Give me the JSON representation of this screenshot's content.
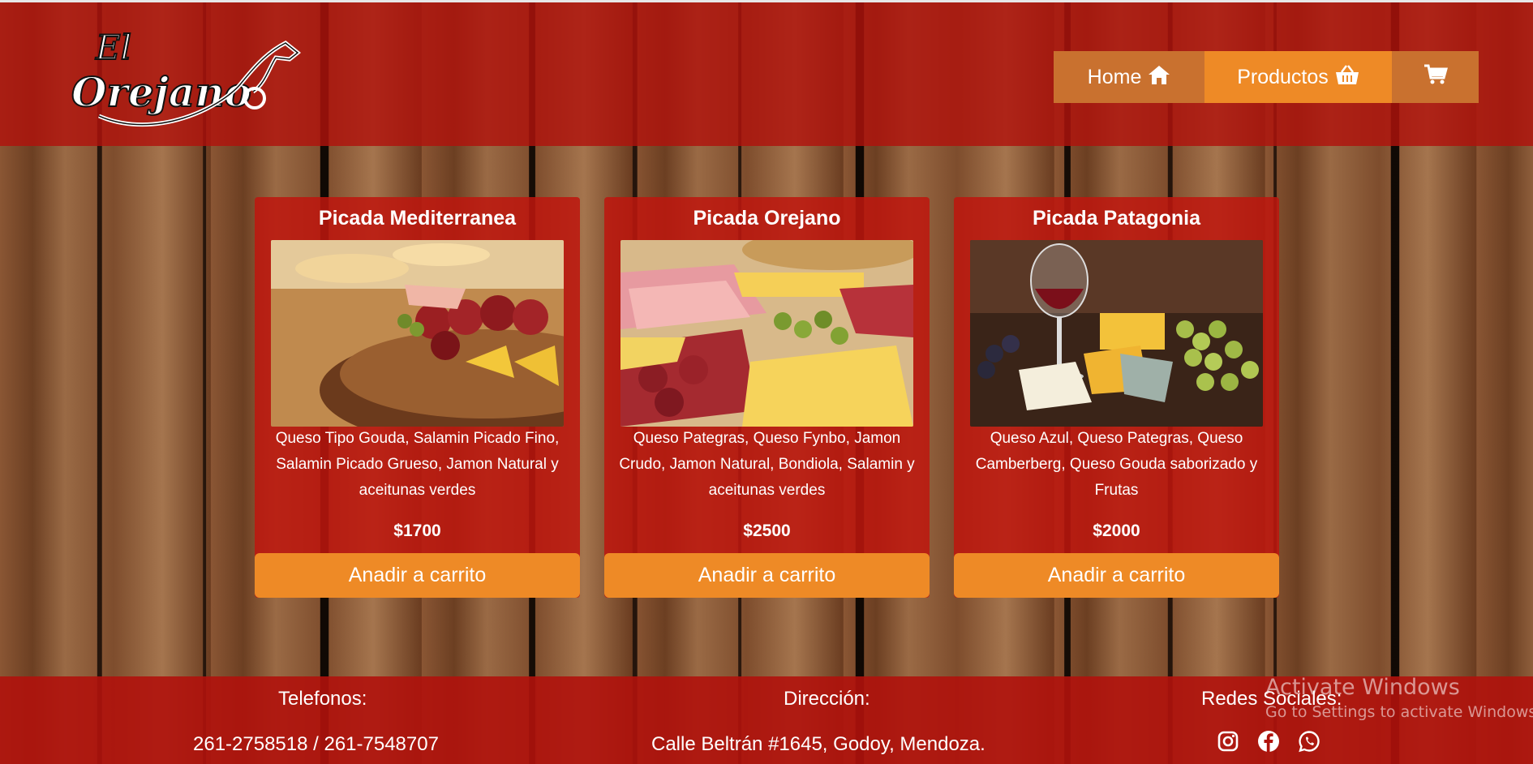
{
  "brand": {
    "logo_text_line1": "El",
    "logo_text_line2": "Orejano"
  },
  "nav": {
    "home_label": "Home",
    "products_label": "Productos",
    "cart_icon": "cart-icon"
  },
  "products": [
    {
      "title": "Picada Mediterranea",
      "description": "Queso Tipo Gouda, Salamin Picado Fino, Salamin Picado Grueso, Jamon Natural y aceitunas verdes",
      "price": "$1700",
      "button": "Anadir a carrito"
    },
    {
      "title": "Picada Orejano",
      "description": "Queso Pategras, Queso Fynbo, Jamon Crudo, Jamon Natural, Bondiola, Salamin y aceitunas verdes",
      "price": "$2500",
      "button": "Anadir a carrito"
    },
    {
      "title": "Picada Patagonia",
      "description": "Queso Azul, Queso Pategras, Queso Camberberg, Queso Gouda saborizado y Frutas",
      "price": "$2000",
      "button": "Anadir a carrito"
    }
  ],
  "footer": {
    "phones_heading": "Telefonos:",
    "phones_value": "261-2758518 / 261-7548707",
    "address_heading": "Dirección:",
    "address_value": "Calle Beltrán #1645, Godoy, Mendoza.",
    "social_heading": "Redes Sociales:",
    "social_icons": [
      "instagram-icon",
      "facebook-icon",
      "whatsapp-icon"
    ]
  },
  "watermark": {
    "line1": "Activate Windows",
    "line2": "Go to Settings to activate Windows."
  },
  "colors": {
    "header_red": "#b0120c",
    "accent_orange": "#ee8a26",
    "nav_muted_orange": "#c9712f"
  }
}
